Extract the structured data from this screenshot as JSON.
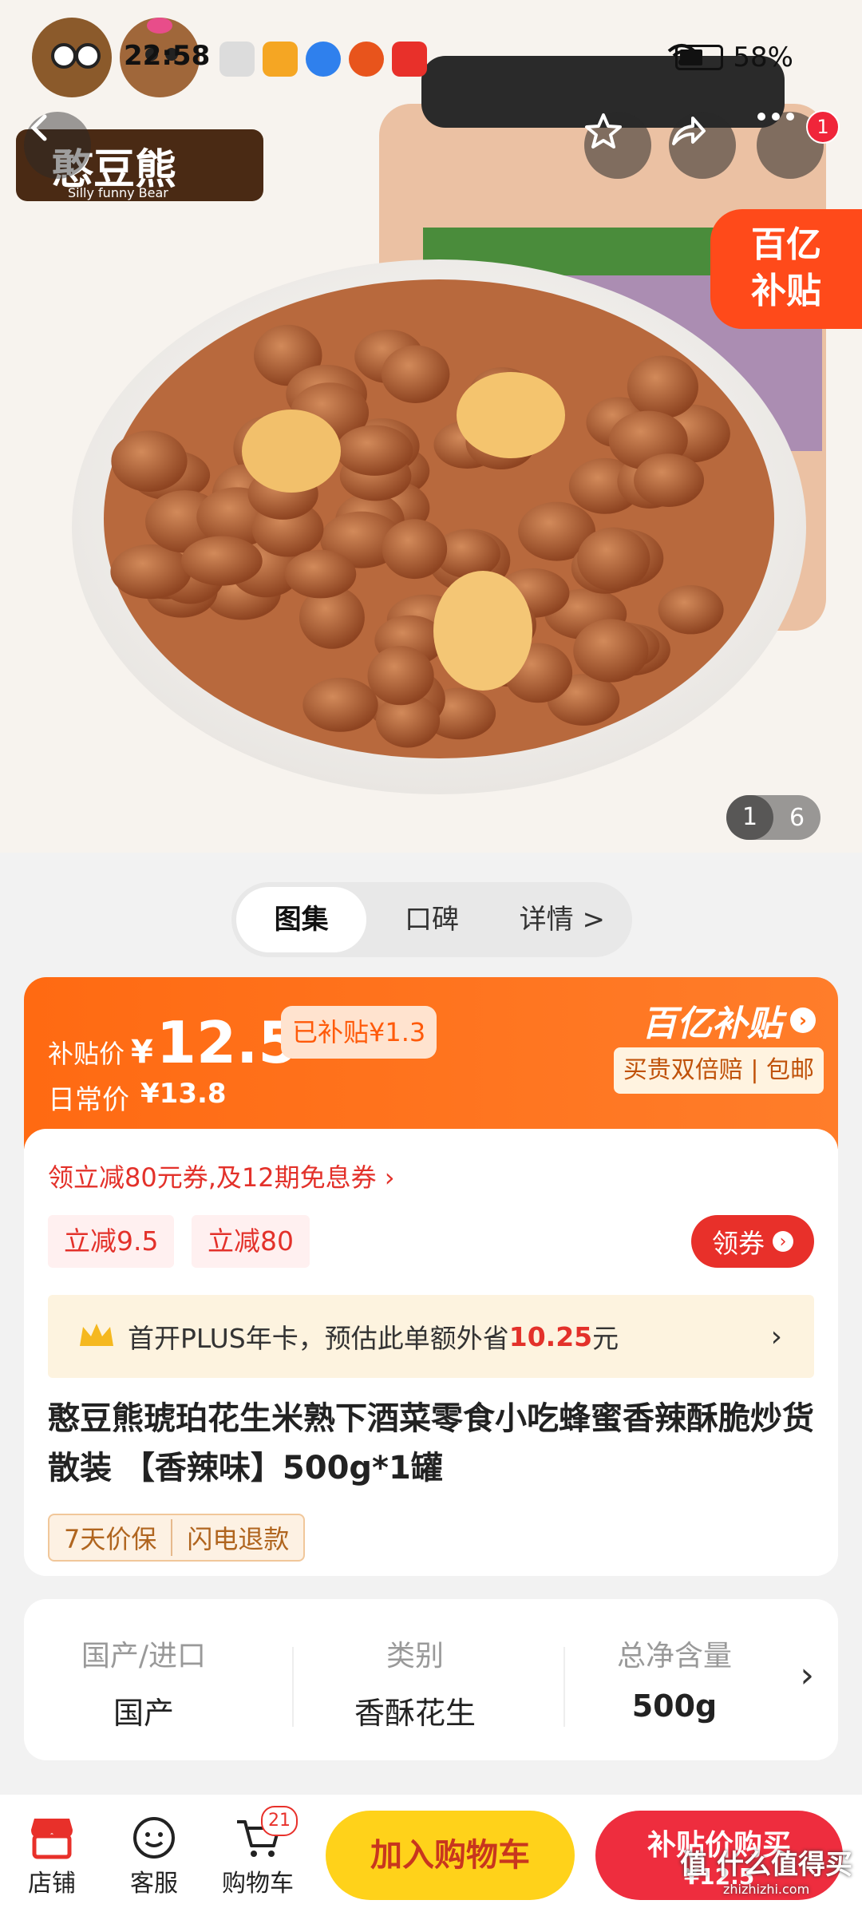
{
  "status": {
    "time": "22:58",
    "battery": "58%",
    "app_icons": [
      "app-1",
      "app-2",
      "app-3",
      "app-4",
      "app-5"
    ]
  },
  "brand": {
    "logo_text": "憨豆熊",
    "logo_sub": "Silly funny Bear"
  },
  "hero": {
    "subsidy_tag_line1": "百亿",
    "subsidy_tag_line2": "补贴",
    "more_badge": "1",
    "pager_current": "1",
    "pager_total": "6",
    "jar_label": "憨豆熊"
  },
  "tabs": [
    "图集",
    "口碑",
    "详情 >"
  ],
  "price": {
    "subsidy_label": "补贴价",
    "currency": "¥",
    "subsidy_price": "12.5",
    "subsidized_amount": "已补贴¥1.3",
    "regular_label": "日常价",
    "regular_price": "¥13.8",
    "brand_title": "百亿补贴",
    "guarantee": "买贵双倍赔 | 包邮",
    "coupon_line": "领立减80元券,及12期免息券 ›",
    "coupons": [
      "立减9.5",
      "立减80"
    ],
    "get_coupon": "领券",
    "plus_prefix": "首开PLUS年卡，预估此单额外省",
    "plus_amount": "10.25",
    "plus_suffix": "元",
    "plus_arrow": "›"
  },
  "product": {
    "title": "憨豆熊琥珀花生米熟下酒菜零食小吃蜂蜜香辣酥脆炒货散装 【香辣味】500g*1罐",
    "services": [
      "7天价保",
      "闪电退款"
    ]
  },
  "specs": [
    {
      "key": "国产/进口",
      "value": "国产"
    },
    {
      "key": "类别",
      "value": "香酥花生"
    },
    {
      "key": "总净含量",
      "value": "500g"
    }
  ],
  "bottom": {
    "store": "店铺",
    "service": "客服",
    "cart": "购物车",
    "cart_count": "21",
    "add_to_cart": "加入购物车",
    "buy_label": "补贴价购买",
    "buy_price": "¥12.5",
    "watermark": "值 什么值得买",
    "watermark_url": "zhizhizhi.com"
  },
  "colors": {
    "accent": "#ff6a12",
    "red": "#e8302a",
    "yellow": "#ffd21a"
  }
}
